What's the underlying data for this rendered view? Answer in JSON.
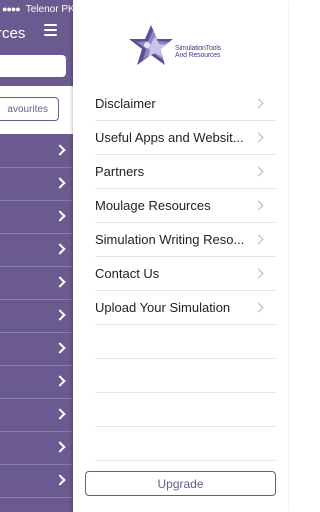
{
  "status_bar": {
    "carrier": "Telenor PK"
  },
  "left_panel": {
    "title": "rces",
    "favourites_label": "avourites",
    "row_count": 11
  },
  "drawer": {
    "logo_text_line1": "SimulationTools",
    "logo_text_line2": "And Resources",
    "menu": [
      {
        "label": "Disclaimer"
      },
      {
        "label": "Useful Apps and Websit..."
      },
      {
        "label": "Partners"
      },
      {
        "label": "Moulage Resources"
      },
      {
        "label": "Simulation Writing Reso..."
      },
      {
        "label": "Contact Us"
      },
      {
        "label": "Upload Your Simulation"
      }
    ],
    "upgrade_label": "Upgrade"
  },
  "colors": {
    "brand": "#6a5a8f",
    "logo": "#4a3f86"
  }
}
